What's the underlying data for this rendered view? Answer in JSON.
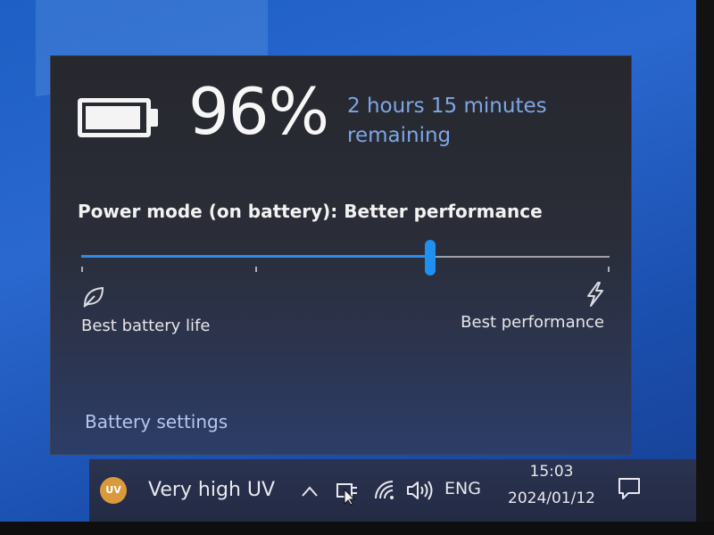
{
  "flyout": {
    "battery_percent": "96%",
    "battery_level": 0.96,
    "remaining_text": "2 hours 15 minutes remaining",
    "power_mode_label": "Power mode (on battery): Better performance",
    "slider_position": 0.66,
    "slider_ticks": [
      0,
      0.33,
      1
    ],
    "left_label": "Best battery life",
    "right_label": "Best performance",
    "settings_link": "Battery settings",
    "icons": [
      "battery-icon",
      "leaf-icon",
      "lightning-bolt-icon"
    ],
    "accent_color": "#2090f0",
    "link_color": "#b4c8ee",
    "remaining_color": "#7ea6e6"
  },
  "taskbar": {
    "weather_badge": "UV",
    "weather_text": "Very high UV",
    "language": "ENG",
    "time": "15:03",
    "date": "2024/01/12",
    "icons": [
      "chevron-up-icon",
      "power-plug-icon",
      "wifi-icon",
      "volume-icon",
      "action-center-icon"
    ]
  }
}
